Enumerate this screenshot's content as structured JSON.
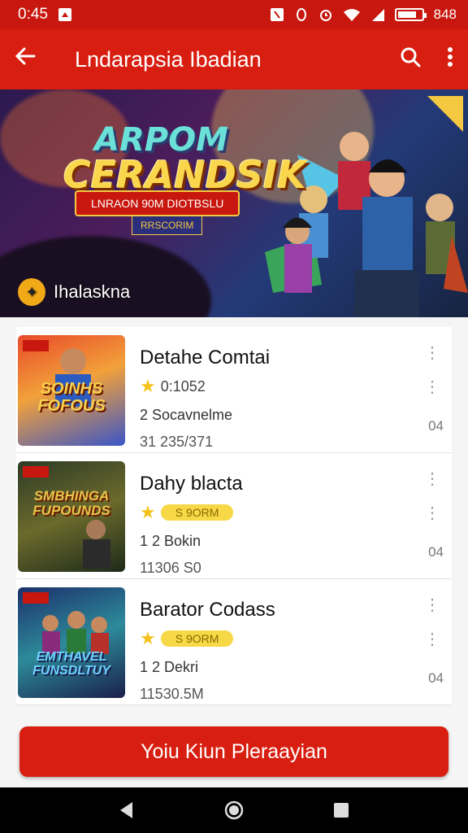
{
  "status_bar": {
    "time": "0:45",
    "battery_label": "848"
  },
  "app_bar": {
    "title": "Lndarapsia Ibadian"
  },
  "hero": {
    "title_line1": "ARPOM",
    "title_line2": "CERANDSIK",
    "ribbon_text": "LNRAON 90M DIOTBSLU",
    "tag_text": "RRSCORIM",
    "caption": "Ihalaskna"
  },
  "games": [
    {
      "name": "Detahe Comtai",
      "rating": "0:1052",
      "rating_pill": "",
      "meta1": "2 Socavnelme",
      "meta2": "31 235/371",
      "count": "04",
      "thumb_text": "SOINHS FOFOUS"
    },
    {
      "name": "Dahy blacta",
      "rating": "",
      "rating_pill": "S 9ORM",
      "meta1": "1 2 Bokin",
      "meta2": "11306 S0",
      "count": "04",
      "thumb_text": "SMBHINGA FUPOUNDS"
    },
    {
      "name": "Barator Codass",
      "rating": "",
      "rating_pill": "S 9ORM",
      "meta1": "1 2 Dekri",
      "meta2": "11530.5M",
      "count": "04",
      "thumb_text": "EMTHAVEL FUNSDLTUY"
    }
  ],
  "cta": {
    "label": "Yoiu Kiun Pleraayian"
  },
  "colors": {
    "primary": "#d81e10",
    "status": "#c8170e",
    "star": "#f4c21c",
    "pill": "#f7d847"
  }
}
